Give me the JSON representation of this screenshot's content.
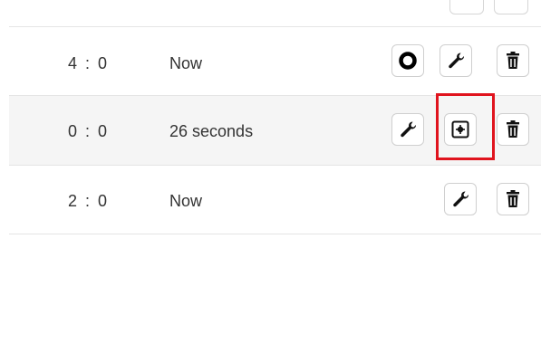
{
  "rows": [
    {
      "score": "4 : 0",
      "time": "Now"
    },
    {
      "score": "0 : 0",
      "time": "26 seconds"
    },
    {
      "score": "2 : 0",
      "time": "Now"
    }
  ],
  "colors": {
    "highlight": "#e0141e",
    "row_alt_bg": "#f5f5f5",
    "border": "#cfcfcf"
  },
  "icons": {
    "record": "record-ring-icon",
    "edit": "wrench-icon",
    "delete": "trash-icon",
    "settings": "gear-square-icon"
  }
}
